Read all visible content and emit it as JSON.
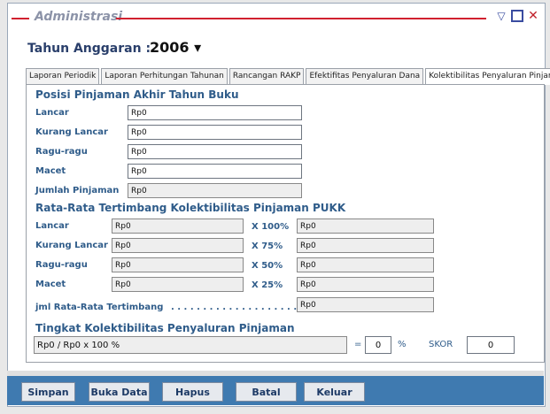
{
  "window": {
    "title": "Administrasi",
    "accent": "#d1202f"
  },
  "header": {
    "tahun_label": "Tahun Anggaran :",
    "tahun_value": "2006 ▾"
  },
  "tabs": [
    {
      "label": "Laporan Periodik"
    },
    {
      "label": "Laporan Perhitungan Tahunan"
    },
    {
      "label": "Rancangan RAKP"
    },
    {
      "label": "Efektifitas Penyaluran Dana"
    },
    {
      "label": "Kolektibilitas Penyaluran Pinjaman"
    }
  ],
  "posisi": {
    "title": "Posisi Pinjaman Akhir Tahun Buku",
    "rows": [
      {
        "label": "Lancar",
        "value": "Rp0"
      },
      {
        "label": "Kurang Lancar",
        "value": "Rp0"
      },
      {
        "label": "Ragu-ragu",
        "value": "Rp0"
      },
      {
        "label": "Macet",
        "value": "Rp0"
      },
      {
        "label": "Jumlah Pinjaman",
        "value": "Rp0"
      }
    ]
  },
  "rata": {
    "title": "Rata-Rata Tertimbang Kolektibilitas Pinjaman PUKK",
    "rows": [
      {
        "label": "Lancar",
        "value": "Rp0",
        "mult": "X 100%",
        "result": "Rp0"
      },
      {
        "label": "Kurang Lancar",
        "value": "Rp0",
        "mult": "X 75%",
        "result": "Rp0"
      },
      {
        "label": "Ragu-ragu",
        "value": "Rp0",
        "mult": "X 50%",
        "result": "Rp0"
      },
      {
        "label": "Macet",
        "value": "Rp0",
        "mult": "X 25%",
        "result": "Rp0"
      }
    ],
    "total_label": "jml Rata-Rata Tertimbang",
    "total_dots": ". . . . . . . . . . . . . . . . . . . . .",
    "total_value": "Rp0"
  },
  "tingkat": {
    "title": "Tingkat Kolektibilitas Penyaluran Pinjaman",
    "formula": "Rp0 / Rp0 x 100 %",
    "equals": "=",
    "percent_value": "0",
    "percent_sign": "%",
    "skor_label": "SKOR",
    "skor_value": "0"
  },
  "buttons": {
    "simpan": "Simpan",
    "buka": "Buka Data",
    "hapus": "Hapus",
    "batal": "Batal",
    "keluar": "Keluar"
  }
}
